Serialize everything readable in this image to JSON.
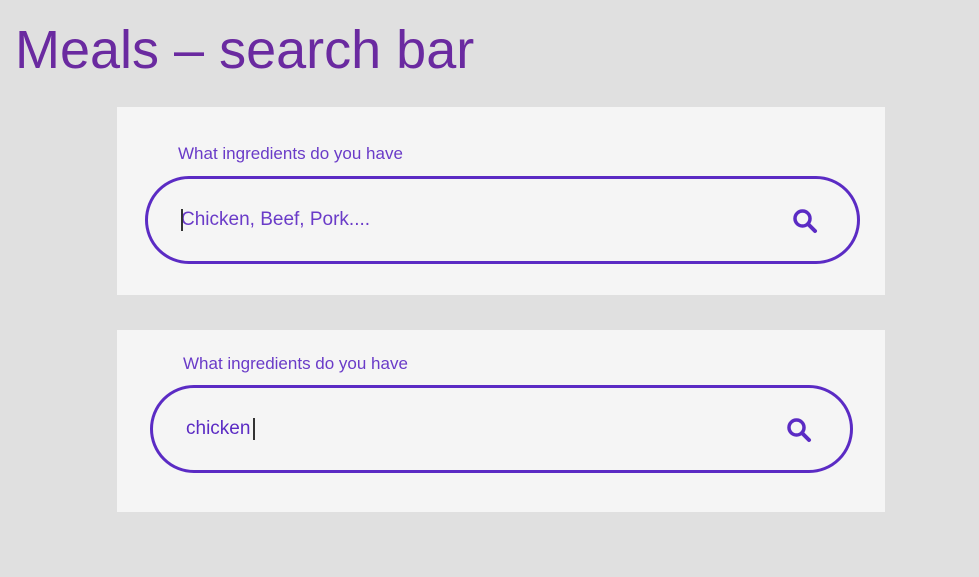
{
  "header": {
    "title": "Meals – search bar"
  },
  "search_states": [
    {
      "label": "What ingredients do you have",
      "placeholder": "Chicken, Beef, Pork....",
      "value": "",
      "icon": "search-icon"
    },
    {
      "label": "What ingredients do you have",
      "placeholder": "",
      "value": "chicken",
      "icon": "search-icon"
    }
  ],
  "colors": {
    "title": "#6a2aa0",
    "accent": "#5b2bc4",
    "label": "#6a3bc8",
    "card_bg": "#f5f5f5",
    "page_bg": "#e0e0e0"
  }
}
